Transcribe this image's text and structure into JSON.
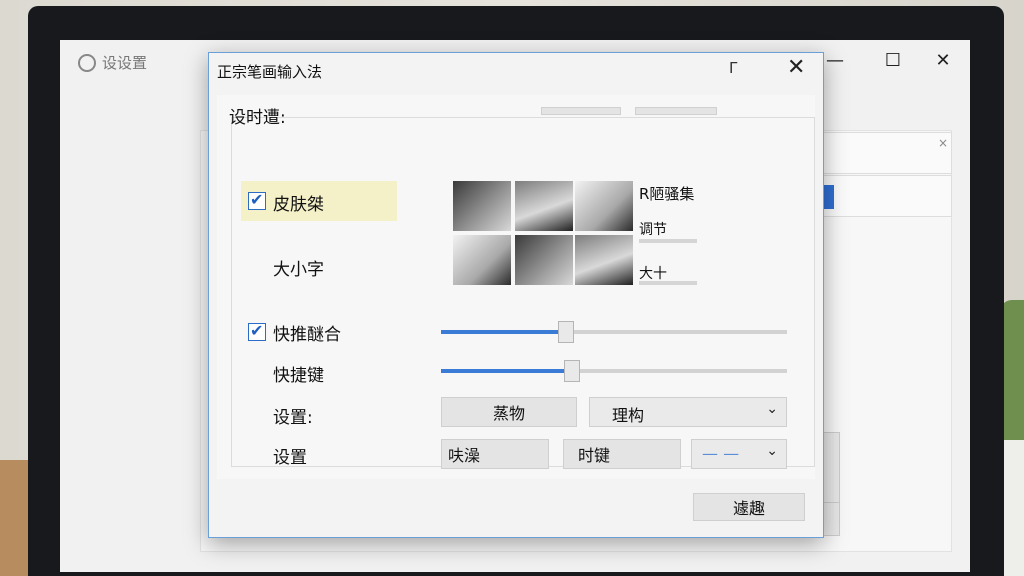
{
  "background_window": {
    "title": "设设置",
    "minimize_glyph": "—",
    "maximize_glyph": "☐",
    "close_glyph": "✕",
    "panel_close_glyph": "×"
  },
  "dialog": {
    "title": "正宗笔画输入法",
    "maximize_glyph": "Γ",
    "close_glyph": "✕",
    "group_label": "设时遭:",
    "skin": {
      "label": "皮肤桀",
      "checked": true
    },
    "size_label": "大小字",
    "preview_side": {
      "title": "R陋骚集",
      "adjust": "调节",
      "size": "大十"
    },
    "shortcut_combo": {
      "label": "快推醚合",
      "checked": true,
      "value": 0.36
    },
    "shortcut_key": {
      "label": "快捷键",
      "value": 0.38
    },
    "setting1": {
      "label": "设置:",
      "button": "蒸物",
      "select": "理构"
    },
    "setting2": {
      "label": "设置",
      "input_label": "呋澡",
      "button": "时键",
      "select_value": "— —"
    },
    "ok_button": "遽趣"
  },
  "icons": {
    "checkbox": "check-icon",
    "dropdown": "chevron-down-icon",
    "close": "close-icon"
  }
}
